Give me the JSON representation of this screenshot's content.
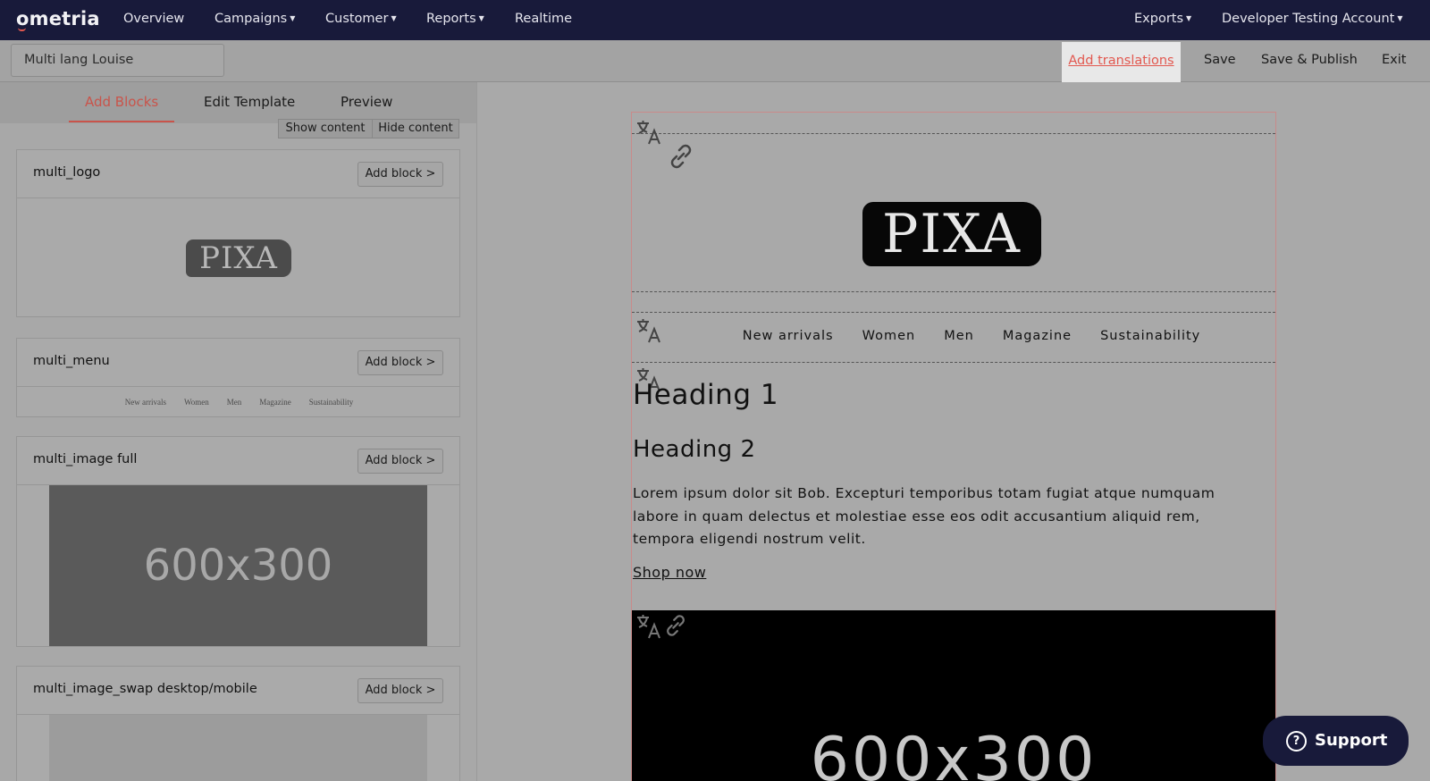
{
  "nav": {
    "logo": "ometria",
    "items": [
      "Overview",
      "Campaigns",
      "Customer",
      "Reports",
      "Realtime"
    ],
    "right": [
      "Exports",
      "Developer Testing Account"
    ]
  },
  "toolbar": {
    "name_value": "Multi lang Louise",
    "add_translations": "Add translations",
    "save": "Save",
    "save_publish": "Save & Publish",
    "exit": "Exit"
  },
  "left": {
    "tabs": [
      "Add Blocks",
      "Edit Template",
      "Preview"
    ],
    "show_content": "Show content",
    "hide_content": "Hide content",
    "add_block_label": "Add block >",
    "blocks": [
      {
        "title": "multi_logo",
        "logo_text": "PIXA"
      },
      {
        "title": "multi_menu",
        "menu": [
          "New arrivals",
          "Women",
          "Men",
          "Magazine",
          "Sustainability"
        ]
      },
      {
        "title": "multi_image full",
        "image_text": "600x300"
      },
      {
        "title": "multi_image_swap desktop/mobile"
      }
    ]
  },
  "preview": {
    "logo_text": "PIXA",
    "menu": [
      "New arrivals",
      "Women",
      "Men",
      "Magazine",
      "Sustainability"
    ],
    "heading1": "Heading 1",
    "heading2": "Heading 2",
    "paragraph": "Lorem ipsum dolor sit Bob. Excepturi temporibus totam fugiat atque numquam labore in quam delectus et molestiae esse eos odit accusantium aliquid rem, tempora eligendi nostrum velit.",
    "link": "Shop now",
    "image_text": "600x300"
  },
  "support": {
    "label": "Support"
  },
  "colors": {
    "nav_bg": "#181a3a",
    "accent": "#e2584f"
  }
}
